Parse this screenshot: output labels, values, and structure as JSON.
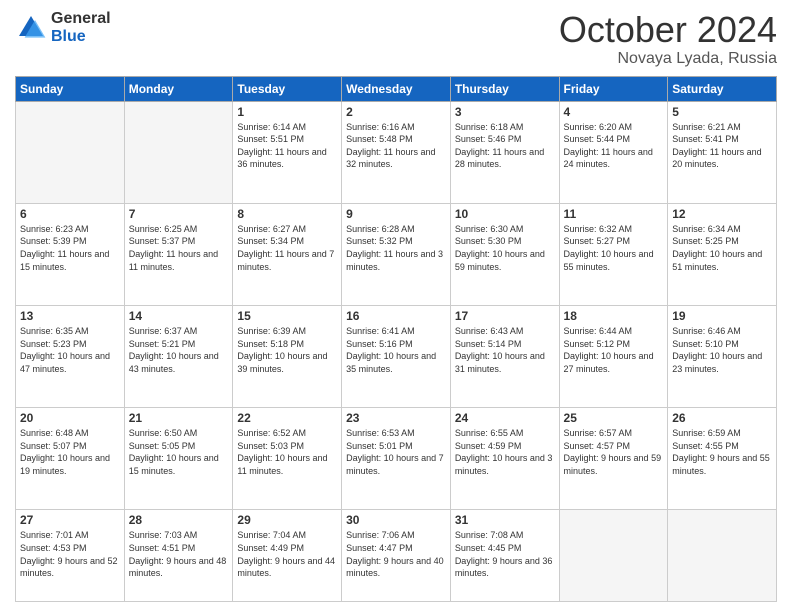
{
  "header": {
    "logo_general": "General",
    "logo_blue": "Blue",
    "month": "October 2024",
    "location": "Novaya Lyada, Russia"
  },
  "weekdays": [
    "Sunday",
    "Monday",
    "Tuesday",
    "Wednesday",
    "Thursday",
    "Friday",
    "Saturday"
  ],
  "days": [
    {
      "date": "",
      "sunrise": "",
      "sunset": "",
      "daylight": ""
    },
    {
      "date": "",
      "sunrise": "",
      "sunset": "",
      "daylight": ""
    },
    {
      "date": "1",
      "sunrise": "Sunrise: 6:14 AM",
      "sunset": "Sunset: 5:51 PM",
      "daylight": "Daylight: 11 hours and 36 minutes."
    },
    {
      "date": "2",
      "sunrise": "Sunrise: 6:16 AM",
      "sunset": "Sunset: 5:48 PM",
      "daylight": "Daylight: 11 hours and 32 minutes."
    },
    {
      "date": "3",
      "sunrise": "Sunrise: 6:18 AM",
      "sunset": "Sunset: 5:46 PM",
      "daylight": "Daylight: 11 hours and 28 minutes."
    },
    {
      "date": "4",
      "sunrise": "Sunrise: 6:20 AM",
      "sunset": "Sunset: 5:44 PM",
      "daylight": "Daylight: 11 hours and 24 minutes."
    },
    {
      "date": "5",
      "sunrise": "Sunrise: 6:21 AM",
      "sunset": "Sunset: 5:41 PM",
      "daylight": "Daylight: 11 hours and 20 minutes."
    },
    {
      "date": "6",
      "sunrise": "Sunrise: 6:23 AM",
      "sunset": "Sunset: 5:39 PM",
      "daylight": "Daylight: 11 hours and 15 minutes."
    },
    {
      "date": "7",
      "sunrise": "Sunrise: 6:25 AM",
      "sunset": "Sunset: 5:37 PM",
      "daylight": "Daylight: 11 hours and 11 minutes."
    },
    {
      "date": "8",
      "sunrise": "Sunrise: 6:27 AM",
      "sunset": "Sunset: 5:34 PM",
      "daylight": "Daylight: 11 hours and 7 minutes."
    },
    {
      "date": "9",
      "sunrise": "Sunrise: 6:28 AM",
      "sunset": "Sunset: 5:32 PM",
      "daylight": "Daylight: 11 hours and 3 minutes."
    },
    {
      "date": "10",
      "sunrise": "Sunrise: 6:30 AM",
      "sunset": "Sunset: 5:30 PM",
      "daylight": "Daylight: 10 hours and 59 minutes."
    },
    {
      "date": "11",
      "sunrise": "Sunrise: 6:32 AM",
      "sunset": "Sunset: 5:27 PM",
      "daylight": "Daylight: 10 hours and 55 minutes."
    },
    {
      "date": "12",
      "sunrise": "Sunrise: 6:34 AM",
      "sunset": "Sunset: 5:25 PM",
      "daylight": "Daylight: 10 hours and 51 minutes."
    },
    {
      "date": "13",
      "sunrise": "Sunrise: 6:35 AM",
      "sunset": "Sunset: 5:23 PM",
      "daylight": "Daylight: 10 hours and 47 minutes."
    },
    {
      "date": "14",
      "sunrise": "Sunrise: 6:37 AM",
      "sunset": "Sunset: 5:21 PM",
      "daylight": "Daylight: 10 hours and 43 minutes."
    },
    {
      "date": "15",
      "sunrise": "Sunrise: 6:39 AM",
      "sunset": "Sunset: 5:18 PM",
      "daylight": "Daylight: 10 hours and 39 minutes."
    },
    {
      "date": "16",
      "sunrise": "Sunrise: 6:41 AM",
      "sunset": "Sunset: 5:16 PM",
      "daylight": "Daylight: 10 hours and 35 minutes."
    },
    {
      "date": "17",
      "sunrise": "Sunrise: 6:43 AM",
      "sunset": "Sunset: 5:14 PM",
      "daylight": "Daylight: 10 hours and 31 minutes."
    },
    {
      "date": "18",
      "sunrise": "Sunrise: 6:44 AM",
      "sunset": "Sunset: 5:12 PM",
      "daylight": "Daylight: 10 hours and 27 minutes."
    },
    {
      "date": "19",
      "sunrise": "Sunrise: 6:46 AM",
      "sunset": "Sunset: 5:10 PM",
      "daylight": "Daylight: 10 hours and 23 minutes."
    },
    {
      "date": "20",
      "sunrise": "Sunrise: 6:48 AM",
      "sunset": "Sunset: 5:07 PM",
      "daylight": "Daylight: 10 hours and 19 minutes."
    },
    {
      "date": "21",
      "sunrise": "Sunrise: 6:50 AM",
      "sunset": "Sunset: 5:05 PM",
      "daylight": "Daylight: 10 hours and 15 minutes."
    },
    {
      "date": "22",
      "sunrise": "Sunrise: 6:52 AM",
      "sunset": "Sunset: 5:03 PM",
      "daylight": "Daylight: 10 hours and 11 minutes."
    },
    {
      "date": "23",
      "sunrise": "Sunrise: 6:53 AM",
      "sunset": "Sunset: 5:01 PM",
      "daylight": "Daylight: 10 hours and 7 minutes."
    },
    {
      "date": "24",
      "sunrise": "Sunrise: 6:55 AM",
      "sunset": "Sunset: 4:59 PM",
      "daylight": "Daylight: 10 hours and 3 minutes."
    },
    {
      "date": "25",
      "sunrise": "Sunrise: 6:57 AM",
      "sunset": "Sunset: 4:57 PM",
      "daylight": "Daylight: 9 hours and 59 minutes."
    },
    {
      "date": "26",
      "sunrise": "Sunrise: 6:59 AM",
      "sunset": "Sunset: 4:55 PM",
      "daylight": "Daylight: 9 hours and 55 minutes."
    },
    {
      "date": "27",
      "sunrise": "Sunrise: 7:01 AM",
      "sunset": "Sunset: 4:53 PM",
      "daylight": "Daylight: 9 hours and 52 minutes."
    },
    {
      "date": "28",
      "sunrise": "Sunrise: 7:03 AM",
      "sunset": "Sunset: 4:51 PM",
      "daylight": "Daylight: 9 hours and 48 minutes."
    },
    {
      "date": "29",
      "sunrise": "Sunrise: 7:04 AM",
      "sunset": "Sunset: 4:49 PM",
      "daylight": "Daylight: 9 hours and 44 minutes."
    },
    {
      "date": "30",
      "sunrise": "Sunrise: 7:06 AM",
      "sunset": "Sunset: 4:47 PM",
      "daylight": "Daylight: 9 hours and 40 minutes."
    },
    {
      "date": "31",
      "sunrise": "Sunrise: 7:08 AM",
      "sunset": "Sunset: 4:45 PM",
      "daylight": "Daylight: 9 hours and 36 minutes."
    },
    {
      "date": "",
      "sunrise": "",
      "sunset": "",
      "daylight": ""
    },
    {
      "date": "",
      "sunrise": "",
      "sunset": "",
      "daylight": ""
    }
  ]
}
